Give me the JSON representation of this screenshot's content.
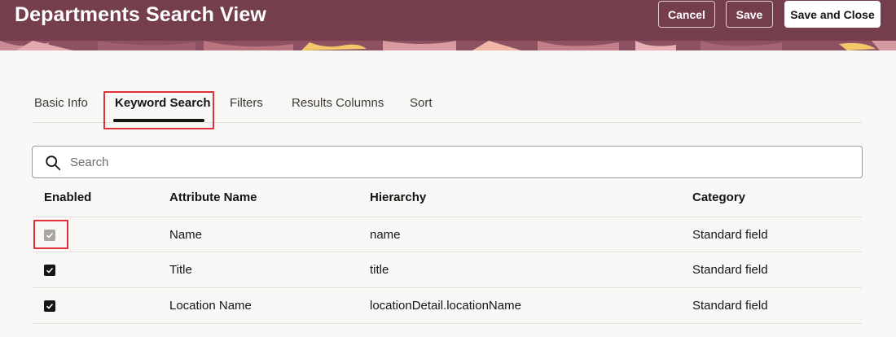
{
  "header": {
    "title": "Departments Search View",
    "cancel_label": "Cancel",
    "save_label": "Save",
    "save_close_label": "Save and Close"
  },
  "tabs": [
    {
      "label": "Basic Info",
      "active": false
    },
    {
      "label": "Keyword Search",
      "active": true
    },
    {
      "label": "Filters",
      "active": false
    },
    {
      "label": "Results Columns",
      "active": false
    },
    {
      "label": "Sort",
      "active": false
    }
  ],
  "search": {
    "placeholder": "Search",
    "value": "",
    "icon": "search-icon"
  },
  "table": {
    "columns": [
      "Enabled",
      "Attribute Name",
      "Hierarchy",
      "Category"
    ],
    "rows": [
      {
        "enabled": true,
        "enabled_disabled": true,
        "attribute": "Name",
        "hierarchy": "name",
        "category": "Standard field"
      },
      {
        "enabled": true,
        "enabled_disabled": false,
        "attribute": "Title",
        "hierarchy": "title",
        "category": "Standard field"
      },
      {
        "enabled": true,
        "enabled_disabled": false,
        "attribute": "Location Name",
        "hierarchy": "locationDetail.locationName",
        "category": "Standard field"
      }
    ]
  },
  "colors": {
    "header_bg": "#733c4b",
    "highlight": "#e0303a",
    "text": "#161513"
  }
}
